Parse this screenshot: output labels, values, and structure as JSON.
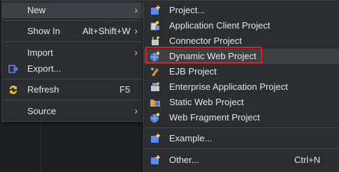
{
  "main_menu": {
    "items": [
      {
        "label": "New",
        "shortcut": "",
        "submenu": true
      },
      {
        "label": "Show In",
        "shortcut": "Alt+Shift+W",
        "submenu": true
      },
      {
        "label": "Import",
        "shortcut": "",
        "submenu": true
      },
      {
        "label": "Export...",
        "shortcut": "",
        "submenu": false
      },
      {
        "label": "Refresh",
        "shortcut": "F5",
        "submenu": false
      },
      {
        "label": "Source",
        "shortcut": "",
        "submenu": true
      }
    ]
  },
  "sub_menu": {
    "items": [
      {
        "label": "Project...",
        "icon": "new-project-icon"
      },
      {
        "label": "Application Client Project",
        "icon": "application-client-project-icon"
      },
      {
        "label": "Connector Project",
        "icon": "connector-project-icon"
      },
      {
        "label": "Dynamic Web Project",
        "icon": "dynamic-web-project-icon"
      },
      {
        "label": "EJB Project",
        "icon": "ejb-project-icon"
      },
      {
        "label": "Enterprise Application Project",
        "icon": "enterprise-application-project-icon"
      },
      {
        "label": "Static Web Project",
        "icon": "static-web-project-icon"
      },
      {
        "label": "Web Fragment Project",
        "icon": "web-fragment-project-icon"
      },
      {
        "label": "Example...",
        "icon": "example-icon"
      },
      {
        "label": "Other...",
        "icon": "other-wizard-icon",
        "shortcut": "Ctrl+N"
      }
    ]
  },
  "colors": {
    "highlight_box": "#e01c1c",
    "menu_bg": "#2b2d30"
  }
}
